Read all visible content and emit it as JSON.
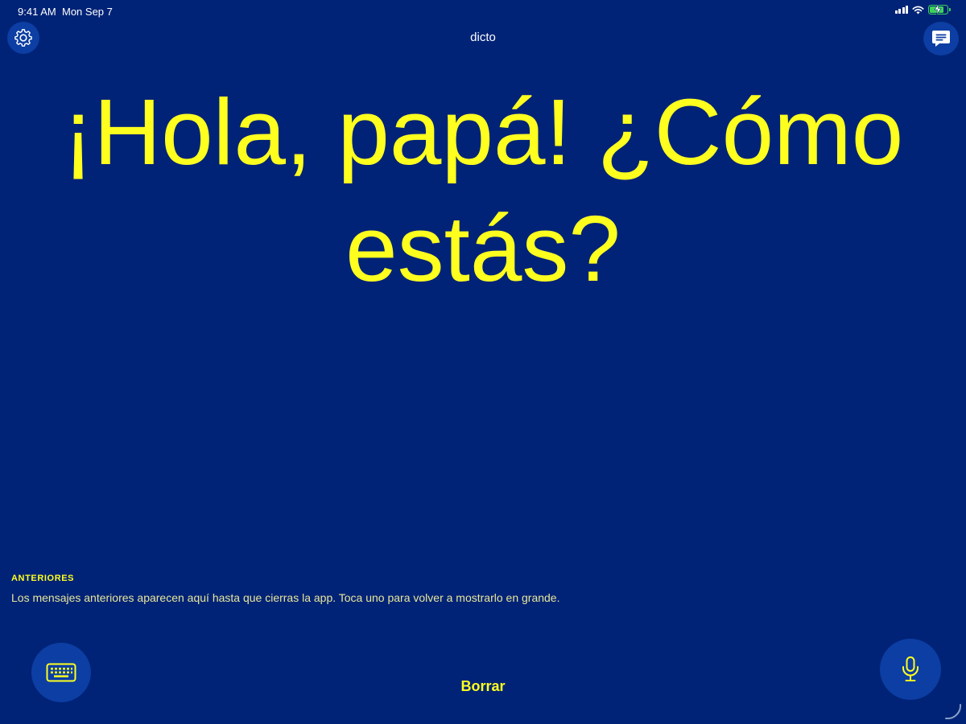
{
  "status_bar": {
    "time": "9:41 AM",
    "date": "Mon Sep 7"
  },
  "header": {
    "title": "dicto",
    "settings_icon": "gear-icon",
    "messages_icon": "chat-bubble-icon"
  },
  "message": {
    "text": "¡Hola, papá! ¿Cómo estás?"
  },
  "previous": {
    "heading": "ANTERIORES",
    "description": "Los mensajes anteriores aparecen aquí hasta que cierras la app. Toca uno para volver a mostrarlo en grande."
  },
  "bottom_bar": {
    "clear_label": "Borrar",
    "keyboard_icon": "keyboard-icon",
    "mic_icon": "microphone-icon"
  },
  "colors": {
    "background": "#002377",
    "button": "#0c3ea3",
    "accent": "#ffff1f",
    "battery": "#3ed35a"
  }
}
